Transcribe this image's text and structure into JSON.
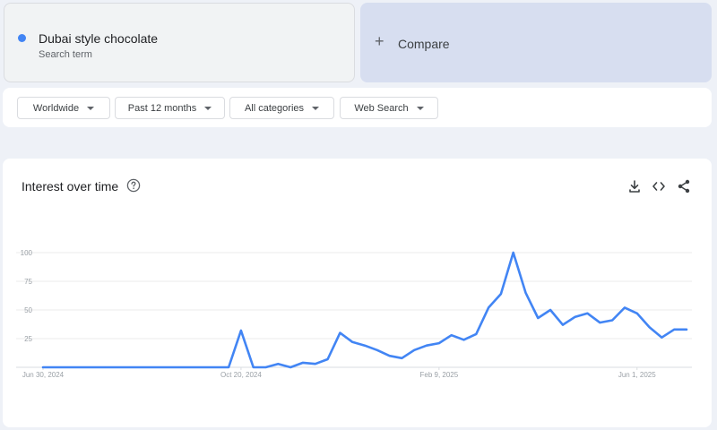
{
  "term": {
    "name": "Dubai style chocolate",
    "subtitle": "Search term",
    "color": "#4285f4"
  },
  "compare": {
    "plus": "+",
    "label": "Compare"
  },
  "filters": {
    "region": "Worldwide",
    "period": "Past 12 months",
    "category": "All categories",
    "search_type": "Web Search"
  },
  "panel": {
    "title": "Interest over time",
    "icons": [
      "help-icon",
      "download-icon",
      "embed-icon",
      "share-icon"
    ]
  },
  "chart_data": {
    "type": "line",
    "title": "",
    "xlabel": "",
    "ylabel": "",
    "ylim": [
      0,
      100
    ],
    "yticks": [
      25,
      50,
      75,
      100
    ],
    "xticks": [
      "Jun 30, 2024",
      "Oct 20, 2024",
      "Feb 9, 2025",
      "Jun 1, 2025"
    ],
    "grid": true,
    "series": [
      {
        "color": "#4285f4",
        "values": [
          0,
          0,
          0,
          0,
          0,
          0,
          0,
          0,
          0,
          0,
          0,
          0,
          0,
          0,
          0,
          0,
          32,
          0,
          0,
          3,
          0,
          4,
          3,
          7,
          30,
          22,
          19,
          15,
          10,
          8,
          15,
          19,
          21,
          28,
          24,
          29,
          52,
          64,
          100,
          65,
          43,
          50,
          37,
          44,
          47,
          39,
          41,
          52,
          47,
          35,
          26,
          33,
          33
        ]
      }
    ]
  }
}
